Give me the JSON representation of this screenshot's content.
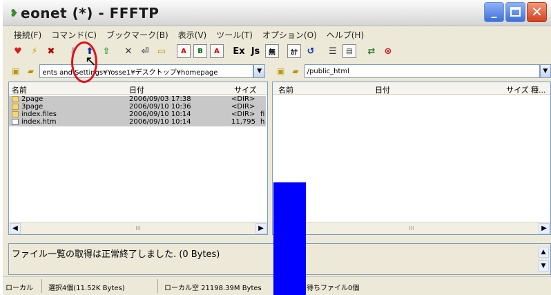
{
  "window": {
    "title": "eonet (*) - FFFTP"
  },
  "menu": [
    "接続(F)",
    "コマンド(C)",
    "ブックマーク(B)",
    "表示(V)",
    "ツール(T)",
    "オプション(O)",
    "ヘルプ(H)"
  ],
  "toolbar": {
    "labels": [
      "Ex",
      "Js",
      "無",
      "ｶﾅ"
    ]
  },
  "local": {
    "path": "ents and Settings¥Yosse1¥デスクトップ¥homepage",
    "columns": {
      "name": "名前",
      "date": "日付",
      "size": "サイズ"
    },
    "files": [
      {
        "name": "2page",
        "date": "2006/09/03 17:38",
        "size": "<DIR>",
        "type": "folder"
      },
      {
        "name": "3page",
        "date": "2006/09/10 10:36",
        "size": "<DIR>",
        "type": "folder"
      },
      {
        "name": "index.files",
        "date": "2006/09/10 10:14",
        "size": "<DIR>",
        "type": "folder",
        "extra": "fi"
      },
      {
        "name": "index.htm",
        "date": "2006/09/10 10:14",
        "size": "11,795",
        "type": "file",
        "extra": "h"
      }
    ]
  },
  "remote": {
    "path": "/public_html",
    "columns": {
      "name": "名前",
      "date": "日付",
      "size": "サイズ",
      "type": "種..."
    }
  },
  "log": {
    "message": "ファイル一覧の取得は正常終了しました. (0 Bytes)"
  },
  "status": {
    "mode": "ローカル",
    "selection": "選択4個(11.52K Bytes)",
    "local_free": "ローカル空 21198.39M Bytes",
    "queue": "待ちファイル0個"
  },
  "colors": {
    "annotation": "#e0101a",
    "overlay": "#0000ff"
  }
}
